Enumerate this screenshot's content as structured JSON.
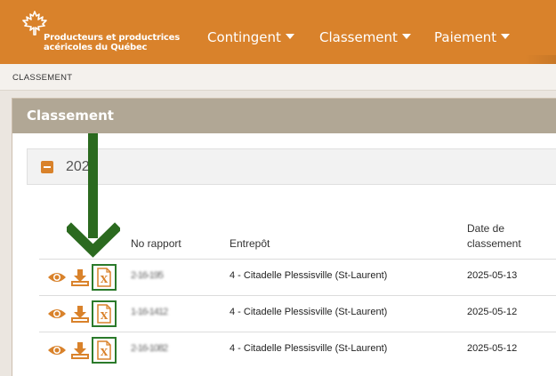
{
  "header": {
    "logo_text_line1": "Producteurs et productrices",
    "logo_text_line2": "acéricoles du Québec",
    "nav": [
      {
        "label": "Contingent"
      },
      {
        "label": "Classement"
      },
      {
        "label": "Paiement"
      }
    ]
  },
  "breadcrumb": "CLASSEMENT",
  "panel": {
    "title": "Classement",
    "year": "2025"
  },
  "table": {
    "headers": {
      "no_rapport": "No rapport",
      "entrepot": "Entrepôt",
      "date_line1": "Date de",
      "date_line2": "classement"
    },
    "rows": [
      {
        "no_rapport": "2-16-195",
        "entrepot": "4 - Citadelle Plessisville (St-Laurent)",
        "date": "2025-05-13"
      },
      {
        "no_rapport": "1-16-1412",
        "entrepot": "4 - Citadelle Plessisville (St-Laurent)",
        "date": "2025-05-12"
      },
      {
        "no_rapport": "2-16-1082",
        "entrepot": "4 - Citadelle Plessisville (St-Laurent)",
        "date": "2025-05-12"
      }
    ]
  },
  "icons": {
    "view": "eye-icon",
    "download": "download-icon",
    "excel": "excel-file-icon",
    "annotation": "down-arrow-icon"
  },
  "colors": {
    "brand_orange": "#d9822b",
    "panel_header": "#b1a795",
    "annotation_green": "#2b7a2b"
  }
}
